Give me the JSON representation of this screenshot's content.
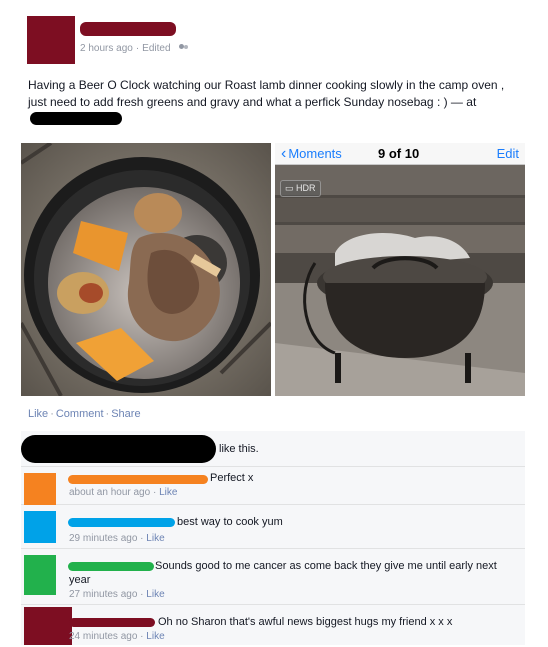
{
  "post": {
    "time": "2 hours ago",
    "edited": "Edited",
    "status_text": "Having a Beer O Clock watching our Roast lamb dinner cooking slowly in the camp oven , just need to add fresh greens and gravy and what a perfick Sunday nosebag : ) — at",
    "icons": {
      "audience": "friends-icon"
    }
  },
  "photo_viewer": {
    "back_label": "Moments",
    "counter": "9 of 10",
    "edit_label": "Edit",
    "hdr_label": "HDR"
  },
  "actions": {
    "like": "Like",
    "comment": "Comment",
    "share": "Share"
  },
  "likes": {
    "text": "like this."
  },
  "comments": [
    {
      "text": "Perfect x",
      "time": "about an hour ago",
      "like": "Like",
      "avatar_color": "#f58220"
    },
    {
      "text": "best way to cook yum",
      "time": "29 minutes ago",
      "like": "Like",
      "avatar_color": "#00a2e8"
    },
    {
      "text": "Sounds good to me cancer as come back they give me until early next year",
      "time": "27 minutes ago",
      "like": "Like",
      "avatar_color": "#22b14c"
    },
    {
      "text": "Oh no Sharon that's awful news biggest hugs my friend x x x",
      "time": "24 minutes ago",
      "like": "Like",
      "avatar_color": "#7d0e22"
    }
  ],
  "colors": {
    "link": "#6d84b4",
    "ios_blue": "#1a7dfc",
    "redact_maroon": "#7d0e22"
  }
}
